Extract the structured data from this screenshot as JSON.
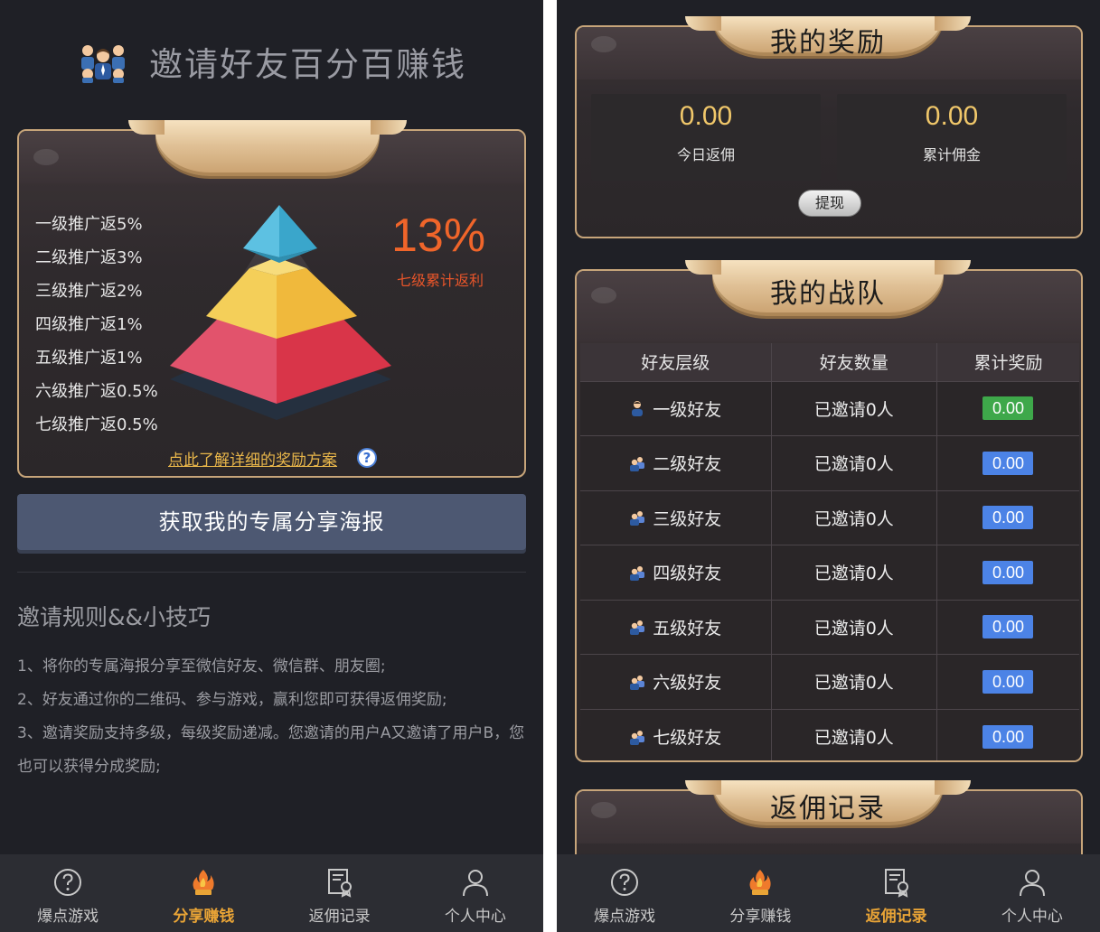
{
  "left": {
    "page_title": "邀请好友百分百赚钱",
    "levels": [
      "一级推广返5%",
      "二级推广返3%",
      "三级推广返2%",
      "四级推广返1%",
      "五级推广返1%",
      "六级推广返0.5%",
      "七级推广返0.5%"
    ],
    "total_rate": "13%",
    "total_rate_label": "七级累计返利",
    "detail_link": "点此了解详细的奖励方案",
    "help_icon_glyph": "?",
    "poster_button": "获取我的专属分享海报",
    "rules_title": "邀请规则&&小技巧",
    "rules": [
      "1、将你的专属海报分享至微信好友、微信群、朋友圈;",
      "2、好友通过你的二维码、参与游戏，赢利您即可获得返佣奖励;",
      "3、邀请奖励支持多级，每级奖励递减。您邀请的用户A又邀请了用户B，您也可以获得分成奖励;"
    ],
    "nav": [
      {
        "label": "爆点游戏",
        "icon": "question-circle-icon"
      },
      {
        "label": "分享赚钱",
        "icon": "flame-icon"
      },
      {
        "label": "返佣记录",
        "icon": "certificate-icon"
      },
      {
        "label": "个人中心",
        "icon": "person-icon"
      }
    ],
    "active_nav": "分享赚钱"
  },
  "right": {
    "reward_title": "我的奖励",
    "today_commission": "0.00",
    "today_label": "今日返佣",
    "total_commission": "0.00",
    "total_label": "累计佣金",
    "withdraw_button": "提现",
    "team_title": "我的战队",
    "table_headers": [
      "好友层级",
      "好友数量",
      "累计奖励"
    ],
    "team_rows": [
      {
        "level": "一级好友",
        "count": "已邀请0人",
        "reward": "0.00",
        "badge_color": "#3ea84a"
      },
      {
        "level": "二级好友",
        "count": "已邀请0人",
        "reward": "0.00",
        "badge_color": "#4c83e6"
      },
      {
        "level": "三级好友",
        "count": "已邀请0人",
        "reward": "0.00",
        "badge_color": "#4c83e6"
      },
      {
        "level": "四级好友",
        "count": "已邀请0人",
        "reward": "0.00",
        "badge_color": "#4c83e6"
      },
      {
        "level": "五级好友",
        "count": "已邀请0人",
        "reward": "0.00",
        "badge_color": "#4c83e6"
      },
      {
        "level": "六级好友",
        "count": "已邀请0人",
        "reward": "0.00",
        "badge_color": "#4c83e6"
      },
      {
        "level": "七级好友",
        "count": "已邀请0人",
        "reward": "0.00",
        "badge_color": "#4c83e6"
      }
    ],
    "records_title": "返佣记录",
    "nav": [
      {
        "label": "爆点游戏",
        "icon": "question-circle-icon"
      },
      {
        "label": "分享赚钱",
        "icon": "flame-icon"
      },
      {
        "label": "返佣记录",
        "icon": "certificate-icon"
      },
      {
        "label": "个人中心",
        "icon": "person-icon"
      }
    ],
    "active_nav": "返佣记录"
  },
  "colors": {
    "accent_orange": "#f0652a",
    "active_nav": "#e9a436",
    "gold_value": "#f0c76a",
    "badge_green": "#3ea84a",
    "badge_blue": "#4c83e6",
    "poster_button_bg": "#4d5872"
  }
}
